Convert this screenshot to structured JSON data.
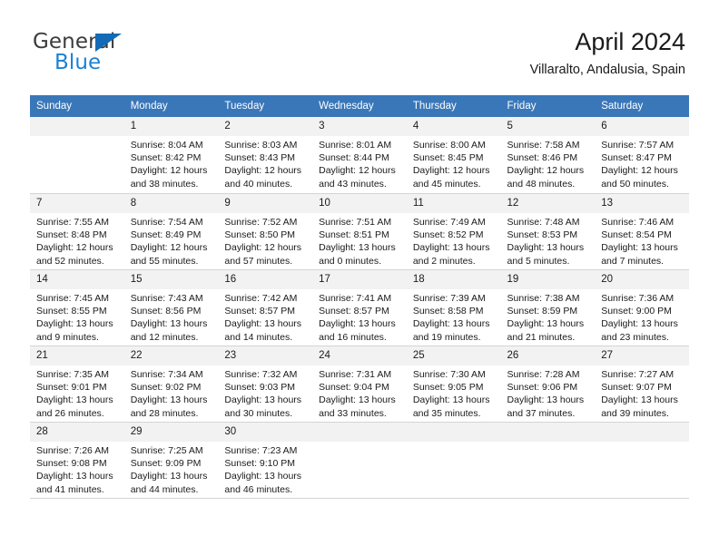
{
  "brand": {
    "name_part1": "General",
    "name_part2": "Blue",
    "accent_color": "#1b81d4",
    "triangle_color": "#136bb5"
  },
  "header": {
    "title": "April 2024",
    "location": "Villaralto, Andalusia, Spain"
  },
  "calendar": {
    "header_color": "#3a77b8",
    "daynum_band_color": "#f2f2f2",
    "weekday_headers": [
      "Sunday",
      "Monday",
      "Tuesday",
      "Wednesday",
      "Thursday",
      "Friday",
      "Saturday"
    ],
    "weeks": [
      [
        {
          "day": "",
          "sunrise": "",
          "sunset": "",
          "daylight_line1": "",
          "daylight_line2": ""
        },
        {
          "day": "1",
          "sunrise": "Sunrise: 8:04 AM",
          "sunset": "Sunset: 8:42 PM",
          "daylight_line1": "Daylight: 12 hours",
          "daylight_line2": "and 38 minutes."
        },
        {
          "day": "2",
          "sunrise": "Sunrise: 8:03 AM",
          "sunset": "Sunset: 8:43 PM",
          "daylight_line1": "Daylight: 12 hours",
          "daylight_line2": "and 40 minutes."
        },
        {
          "day": "3",
          "sunrise": "Sunrise: 8:01 AM",
          "sunset": "Sunset: 8:44 PM",
          "daylight_line1": "Daylight: 12 hours",
          "daylight_line2": "and 43 minutes."
        },
        {
          "day": "4",
          "sunrise": "Sunrise: 8:00 AM",
          "sunset": "Sunset: 8:45 PM",
          "daylight_line1": "Daylight: 12 hours",
          "daylight_line2": "and 45 minutes."
        },
        {
          "day": "5",
          "sunrise": "Sunrise: 7:58 AM",
          "sunset": "Sunset: 8:46 PM",
          "daylight_line1": "Daylight: 12 hours",
          "daylight_line2": "and 48 minutes."
        },
        {
          "day": "6",
          "sunrise": "Sunrise: 7:57 AM",
          "sunset": "Sunset: 8:47 PM",
          "daylight_line1": "Daylight: 12 hours",
          "daylight_line2": "and 50 minutes."
        }
      ],
      [
        {
          "day": "7",
          "sunrise": "Sunrise: 7:55 AM",
          "sunset": "Sunset: 8:48 PM",
          "daylight_line1": "Daylight: 12 hours",
          "daylight_line2": "and 52 minutes."
        },
        {
          "day": "8",
          "sunrise": "Sunrise: 7:54 AM",
          "sunset": "Sunset: 8:49 PM",
          "daylight_line1": "Daylight: 12 hours",
          "daylight_line2": "and 55 minutes."
        },
        {
          "day": "9",
          "sunrise": "Sunrise: 7:52 AM",
          "sunset": "Sunset: 8:50 PM",
          "daylight_line1": "Daylight: 12 hours",
          "daylight_line2": "and 57 minutes."
        },
        {
          "day": "10",
          "sunrise": "Sunrise: 7:51 AM",
          "sunset": "Sunset: 8:51 PM",
          "daylight_line1": "Daylight: 13 hours",
          "daylight_line2": "and 0 minutes."
        },
        {
          "day": "11",
          "sunrise": "Sunrise: 7:49 AM",
          "sunset": "Sunset: 8:52 PM",
          "daylight_line1": "Daylight: 13 hours",
          "daylight_line2": "and 2 minutes."
        },
        {
          "day": "12",
          "sunrise": "Sunrise: 7:48 AM",
          "sunset": "Sunset: 8:53 PM",
          "daylight_line1": "Daylight: 13 hours",
          "daylight_line2": "and 5 minutes."
        },
        {
          "day": "13",
          "sunrise": "Sunrise: 7:46 AM",
          "sunset": "Sunset: 8:54 PM",
          "daylight_line1": "Daylight: 13 hours",
          "daylight_line2": "and 7 minutes."
        }
      ],
      [
        {
          "day": "14",
          "sunrise": "Sunrise: 7:45 AM",
          "sunset": "Sunset: 8:55 PM",
          "daylight_line1": "Daylight: 13 hours",
          "daylight_line2": "and 9 minutes."
        },
        {
          "day": "15",
          "sunrise": "Sunrise: 7:43 AM",
          "sunset": "Sunset: 8:56 PM",
          "daylight_line1": "Daylight: 13 hours",
          "daylight_line2": "and 12 minutes."
        },
        {
          "day": "16",
          "sunrise": "Sunrise: 7:42 AM",
          "sunset": "Sunset: 8:57 PM",
          "daylight_line1": "Daylight: 13 hours",
          "daylight_line2": "and 14 minutes."
        },
        {
          "day": "17",
          "sunrise": "Sunrise: 7:41 AM",
          "sunset": "Sunset: 8:57 PM",
          "daylight_line1": "Daylight: 13 hours",
          "daylight_line2": "and 16 minutes."
        },
        {
          "day": "18",
          "sunrise": "Sunrise: 7:39 AM",
          "sunset": "Sunset: 8:58 PM",
          "daylight_line1": "Daylight: 13 hours",
          "daylight_line2": "and 19 minutes."
        },
        {
          "day": "19",
          "sunrise": "Sunrise: 7:38 AM",
          "sunset": "Sunset: 8:59 PM",
          "daylight_line1": "Daylight: 13 hours",
          "daylight_line2": "and 21 minutes."
        },
        {
          "day": "20",
          "sunrise": "Sunrise: 7:36 AM",
          "sunset": "Sunset: 9:00 PM",
          "daylight_line1": "Daylight: 13 hours",
          "daylight_line2": "and 23 minutes."
        }
      ],
      [
        {
          "day": "21",
          "sunrise": "Sunrise: 7:35 AM",
          "sunset": "Sunset: 9:01 PM",
          "daylight_line1": "Daylight: 13 hours",
          "daylight_line2": "and 26 minutes."
        },
        {
          "day": "22",
          "sunrise": "Sunrise: 7:34 AM",
          "sunset": "Sunset: 9:02 PM",
          "daylight_line1": "Daylight: 13 hours",
          "daylight_line2": "and 28 minutes."
        },
        {
          "day": "23",
          "sunrise": "Sunrise: 7:32 AM",
          "sunset": "Sunset: 9:03 PM",
          "daylight_line1": "Daylight: 13 hours",
          "daylight_line2": "and 30 minutes."
        },
        {
          "day": "24",
          "sunrise": "Sunrise: 7:31 AM",
          "sunset": "Sunset: 9:04 PM",
          "daylight_line1": "Daylight: 13 hours",
          "daylight_line2": "and 33 minutes."
        },
        {
          "day": "25",
          "sunrise": "Sunrise: 7:30 AM",
          "sunset": "Sunset: 9:05 PM",
          "daylight_line1": "Daylight: 13 hours",
          "daylight_line2": "and 35 minutes."
        },
        {
          "day": "26",
          "sunrise": "Sunrise: 7:28 AM",
          "sunset": "Sunset: 9:06 PM",
          "daylight_line1": "Daylight: 13 hours",
          "daylight_line2": "and 37 minutes."
        },
        {
          "day": "27",
          "sunrise": "Sunrise: 7:27 AM",
          "sunset": "Sunset: 9:07 PM",
          "daylight_line1": "Daylight: 13 hours",
          "daylight_line2": "and 39 minutes."
        }
      ],
      [
        {
          "day": "28",
          "sunrise": "Sunrise: 7:26 AM",
          "sunset": "Sunset: 9:08 PM",
          "daylight_line1": "Daylight: 13 hours",
          "daylight_line2": "and 41 minutes."
        },
        {
          "day": "29",
          "sunrise": "Sunrise: 7:25 AM",
          "sunset": "Sunset: 9:09 PM",
          "daylight_line1": "Daylight: 13 hours",
          "daylight_line2": "and 44 minutes."
        },
        {
          "day": "30",
          "sunrise": "Sunrise: 7:23 AM",
          "sunset": "Sunset: 9:10 PM",
          "daylight_line1": "Daylight: 13 hours",
          "daylight_line2": "and 46 minutes."
        },
        {
          "day": "",
          "sunrise": "",
          "sunset": "",
          "daylight_line1": "",
          "daylight_line2": ""
        },
        {
          "day": "",
          "sunrise": "",
          "sunset": "",
          "daylight_line1": "",
          "daylight_line2": ""
        },
        {
          "day": "",
          "sunrise": "",
          "sunset": "",
          "daylight_line1": "",
          "daylight_line2": ""
        },
        {
          "day": "",
          "sunrise": "",
          "sunset": "",
          "daylight_line1": "",
          "daylight_line2": ""
        }
      ]
    ]
  }
}
